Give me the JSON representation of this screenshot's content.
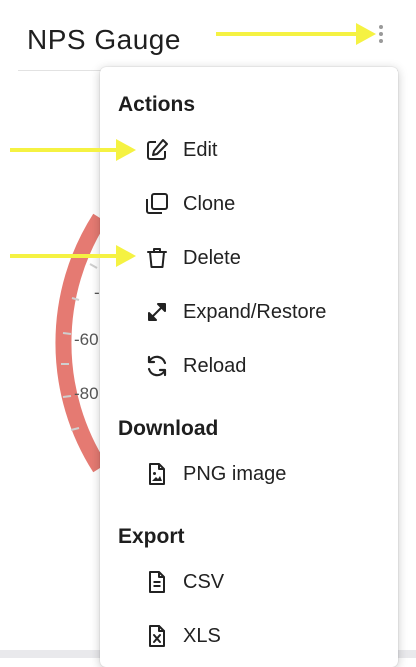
{
  "widget": {
    "title": "NPS Gauge",
    "gauge_ticks_visible": [
      "-60",
      "-80"
    ],
    "gauge_arc_color": "#e57a72"
  },
  "menu": {
    "sections": [
      {
        "header": "Actions",
        "items": [
          {
            "label": "Edit",
            "icon": "edit-icon"
          },
          {
            "label": "Clone",
            "icon": "clone-icon"
          },
          {
            "label": "Delete",
            "icon": "trash-icon"
          },
          {
            "label": "Expand/Restore",
            "icon": "expand-icon"
          },
          {
            "label": "Reload",
            "icon": "reload-icon"
          }
        ]
      },
      {
        "header": "Download",
        "items": [
          {
            "label": "PNG image",
            "icon": "image-file-icon"
          }
        ]
      },
      {
        "header": "Export",
        "items": [
          {
            "label": "CSV",
            "icon": "csv-file-icon"
          },
          {
            "label": "XLS",
            "icon": "xls-file-icon"
          }
        ]
      }
    ]
  },
  "annotations": {
    "arrow_color": "#f5f242"
  }
}
